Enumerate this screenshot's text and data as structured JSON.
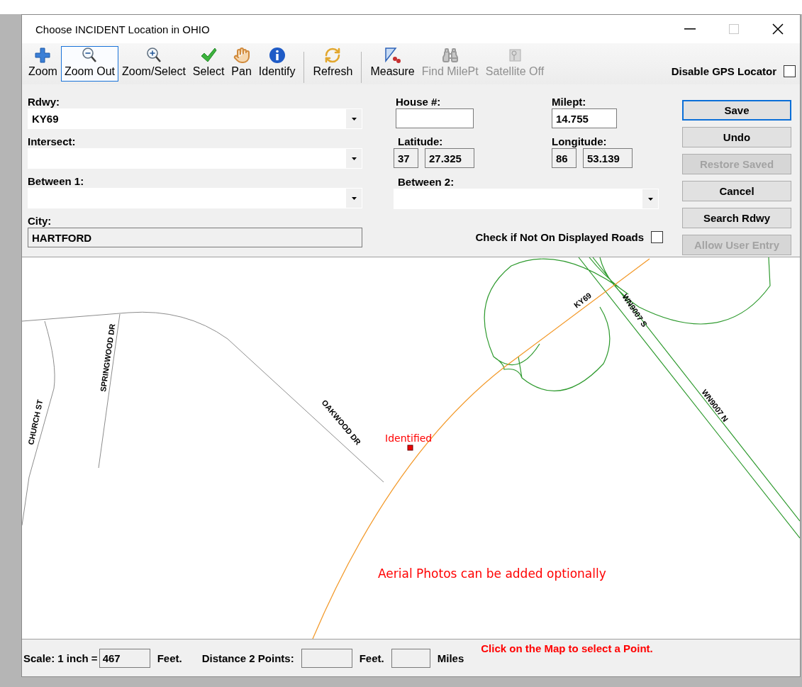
{
  "window": {
    "title": "Choose INCIDENT Location in OHIO"
  },
  "toolbar": {
    "groups": [
      [
        {
          "label": "Zoom",
          "selected": false,
          "disabled": false
        },
        {
          "label": "Zoom Out",
          "selected": true,
          "disabled": false
        },
        {
          "label": "Zoom/Select",
          "selected": false,
          "disabled": false
        },
        {
          "label": "Select",
          "selected": false,
          "disabled": false
        },
        {
          "label": "Pan",
          "selected": false,
          "disabled": false
        },
        {
          "label": "Identify",
          "selected": false,
          "disabled": false
        }
      ],
      [
        {
          "label": "Refresh",
          "selected": false,
          "disabled": false
        }
      ],
      [
        {
          "label": "Measure",
          "selected": false,
          "disabled": false
        },
        {
          "label": "Find MilePt",
          "selected": false,
          "disabled": true
        },
        {
          "label": "Satellite Off",
          "selected": false,
          "disabled": true
        }
      ]
    ],
    "gps_checkbox": {
      "label": "Disable GPS Locator",
      "checked": false
    }
  },
  "form": {
    "rdwy": {
      "label": "Rdwy:",
      "value": "KY69"
    },
    "intersect": {
      "label": "Intersect:"
    },
    "between_1": {
      "label": "Between 1:"
    },
    "city": {
      "label": "City:",
      "value": "HARTFORD"
    },
    "house": {
      "label": "House #:"
    },
    "milept": {
      "label": "Milept:",
      "value": "14.755"
    },
    "latitude": {
      "label": "Latitude:",
      "degrees": "37",
      "minutes": "27.325"
    },
    "longitude": {
      "label": "Longitude:",
      "degrees": "86",
      "minutes": "53.139"
    },
    "between_2": {
      "label": "Between 2:"
    },
    "not_on_roads": {
      "label": "Check if Not On Displayed Roads",
      "checked": false
    }
  },
  "buttons": [
    {
      "label": "Save",
      "default": true,
      "disabled": false
    },
    {
      "label": "Undo",
      "default": false,
      "disabled": false
    },
    {
      "label": "Restore Saved",
      "default": false,
      "disabled": true
    },
    {
      "label": "Cancel",
      "default": false,
      "disabled": false
    },
    {
      "label": "Search Rdwy",
      "default": false,
      "disabled": false
    },
    {
      "label": "Allow User Entry",
      "default": false,
      "disabled": true
    }
  ],
  "map": {
    "labels": [
      "KY69",
      "WN9007 S",
      "WN9007 N",
      "OAKWOOD DR",
      "SPRINGWOOD DR",
      "CHURCH ST"
    ],
    "marker": {
      "label": "Identified"
    },
    "note": "Aerial Photos can be added optionally"
  },
  "status_bar": {
    "scale_label": "Scale: 1 inch =",
    "scale_value": "467",
    "scale_unit": "Feet.",
    "distance_label": "Distance 2 Points:",
    "feet_unit": "Feet.",
    "miles_unit": "Miles",
    "hint": "Click on the Map to select a Point."
  }
}
